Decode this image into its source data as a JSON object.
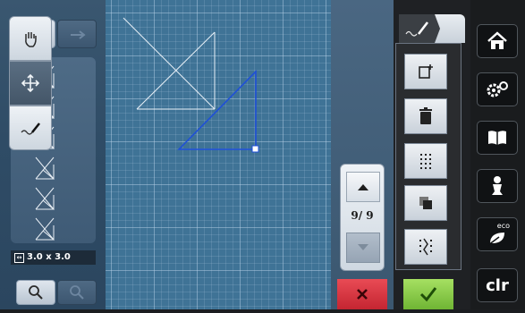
{
  "left_panel": {
    "size_label": "3.0 x 3.0"
  },
  "page_navigator": {
    "page_display": "9/ 9"
  },
  "nav": {
    "clr_label": "clr",
    "eco_label": "eco"
  },
  "icons": {
    "undo": "undo-icon",
    "redo": "redo-icon",
    "hand": "hand-icon",
    "move": "move-arrows-icon",
    "stitch_line": "stitch-line-icon",
    "add": "add-icon",
    "delete": "trash-icon",
    "grid": "grid-dots-icon",
    "duplicate": "duplicate-icon",
    "split": "split-icon",
    "home": "home-icon",
    "settings": "gear-icon",
    "tutorial": "book-icon",
    "help": "help-icon",
    "eco": "eco-leaf-icon",
    "zoom_in": "zoom-in-icon",
    "zoom_out": "zoom-out-icon",
    "cancel": "close-icon",
    "confirm": "check-icon"
  },
  "colors": {
    "canvas_bg": "#3f7396",
    "selected_stroke": "#1f4fd8",
    "confirm_green": "#7fc83f",
    "cancel_red": "#d62e3a"
  }
}
